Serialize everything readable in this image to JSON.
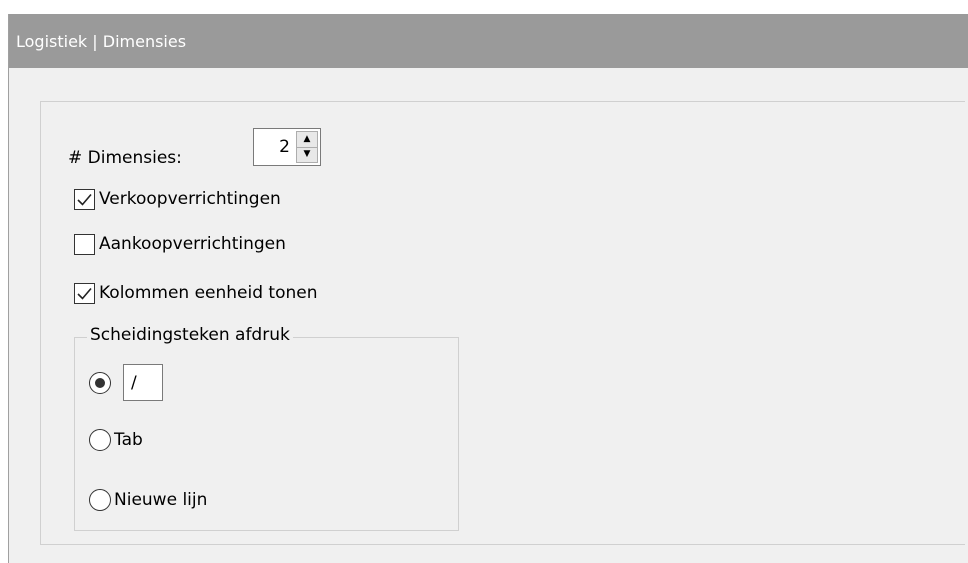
{
  "window": {
    "title": "Logistiek | Dimensies"
  },
  "dimensions": {
    "label": "# Dimensies:",
    "value": "2"
  },
  "options": [
    {
      "label": "Verkoopverrichtingen",
      "checked": true
    },
    {
      "label": "Aankoopverrichtingen",
      "checked": false
    },
    {
      "label": "Kolommen eenheid tonen",
      "checked": true
    }
  ],
  "separator_group": {
    "title": "Scheidingsteken afdruk",
    "custom_value": "/",
    "custom_selected": true,
    "tab_label": "Tab",
    "tab_selected": false,
    "newline_label": "Nieuwe lijn",
    "newline_selected": false
  },
  "colors": {
    "titlebar": "#9a9a9a",
    "panel": "#f0f0f0"
  }
}
